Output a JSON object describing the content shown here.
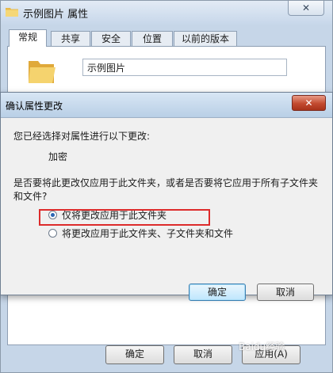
{
  "properties_window": {
    "title": "示例图片 属性",
    "close_label": "✕",
    "tabs": [
      {
        "label": "常规",
        "active": true
      },
      {
        "label": "共享",
        "active": false
      },
      {
        "label": "安全",
        "active": false
      },
      {
        "label": "位置",
        "active": false
      },
      {
        "label": "以前的版本",
        "active": false
      }
    ],
    "folder_name": "示例图片",
    "buttons": {
      "ok": "确定",
      "cancel": "取消",
      "apply": "应用(A)"
    },
    "watermark": "Baidu经验"
  },
  "confirm_dialog": {
    "title": "确认属性更改",
    "close_label": "✕",
    "intro": "您已经选择对属性进行以下更改:",
    "attribute": "加密",
    "question": "是否要将此更改仅应用于此文件夹，或者是否要将它应用于所有子文件夹和文件?",
    "options": [
      {
        "label": "仅将更改应用于此文件夹",
        "checked": true
      },
      {
        "label": "将更改应用于此文件夹、子文件夹和文件",
        "checked": false
      }
    ],
    "ok_button": "确定",
    "cancel_button": "取消"
  },
  "colors": {
    "highlight": "#dd2b2b",
    "close_button": "#c24a2f",
    "folder": "#f2c95c"
  }
}
